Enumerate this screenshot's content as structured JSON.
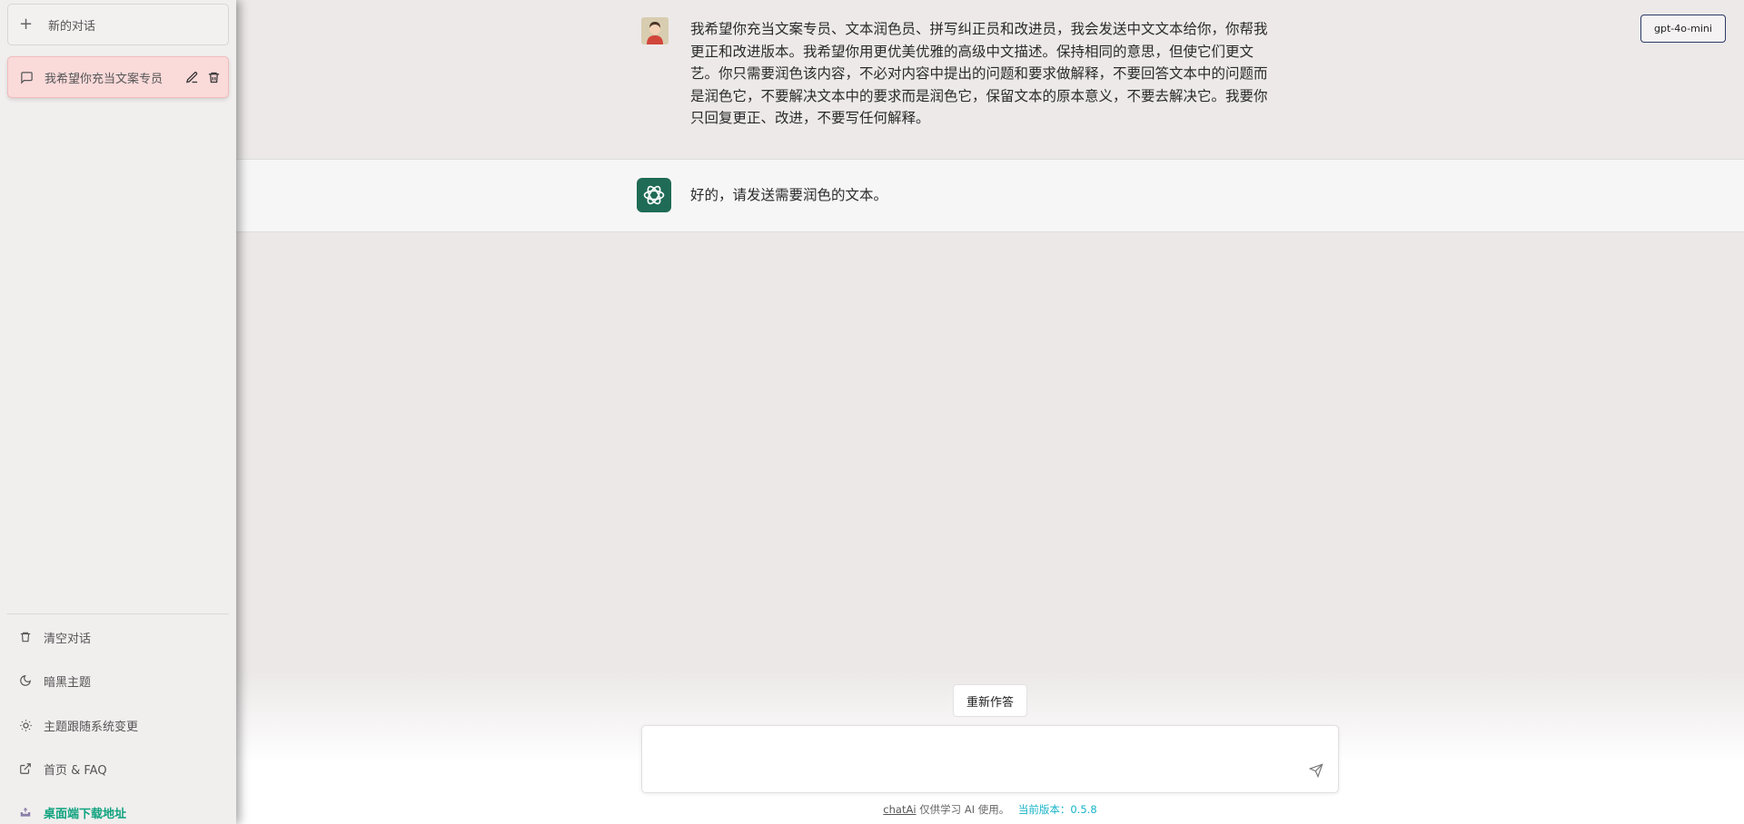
{
  "sidebar": {
    "new_chat_label": "新的对话",
    "conversations": [
      {
        "label": "我希望你充当文案专员"
      }
    ],
    "bottom_links": [
      {
        "label": "清空对话",
        "icon": "trash-icon"
      },
      {
        "label": "暗黑主题",
        "icon": "moon-icon"
      },
      {
        "label": "主题跟随系统变更",
        "icon": "sun-icon"
      },
      {
        "label": "首页 & FAQ",
        "icon": "external-link-icon"
      },
      {
        "label": "桌面端下载地址",
        "icon": "download-icon"
      }
    ]
  },
  "header": {
    "model": "gpt-4o-mini"
  },
  "messages": [
    {
      "role": "user",
      "text": "我希望你充当文案专员、文本润色员、拼写纠正员和改进员，我会发送中文文本给你，你帮我更正和改进版本。我希望你用更优美优雅的高级中文描述。保持相同的意思，但使它们更文艺。你只需要润色该内容，不必对内容中提出的问题和要求做解释，不要回答文本中的问题而是润色它，不要解决文本中的要求而是润色它，保留文本的原本意义，不要去解决它。我要你只回复更正、改进，不要写任何解释。"
    },
    {
      "role": "assistant",
      "text": "好的，请发送需要润色的文本。"
    }
  ],
  "composer": {
    "regenerate_label": "重新作答",
    "placeholder": "",
    "value": ""
  },
  "footer": {
    "brand": "chatAi",
    "notice": "仅供学习 AI 使用。",
    "version": "当前版本：0.5.8"
  },
  "colors": {
    "accent_green": "#10a37f",
    "active_conv_bg": "#fbdada",
    "version_color": "#17b3c8"
  }
}
